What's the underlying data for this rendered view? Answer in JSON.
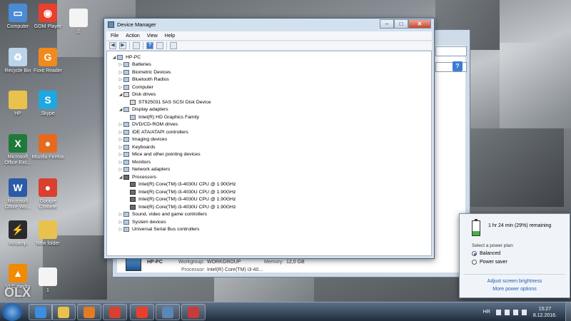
{
  "desktop": {
    "icons": [
      {
        "label": "Computer",
        "icon": "computer-icon",
        "color": "#4a8bd4"
      },
      {
        "label": "GOM Player",
        "icon": "gom-player-icon",
        "color": "#e8402c"
      },
      {
        "label": "2",
        "icon": "image-file-icon",
        "color": "#f4f4f4"
      },
      {
        "label": "Recycle Bin",
        "icon": "recycle-bin-icon",
        "color": "#bcd4ea"
      },
      {
        "label": "Foxit Reader",
        "icon": "foxit-reader-icon",
        "color": "#f08a1c"
      },
      {
        "label": "HP",
        "icon": "folder-icon",
        "color": "#e9c24d"
      },
      {
        "label": "Skype",
        "icon": "skype-icon",
        "color": "#1ea7e1"
      },
      {
        "label": "Microsoft Office Exc...",
        "icon": "excel-icon",
        "color": "#1f7a3a"
      },
      {
        "label": "Mozilla Firefox",
        "icon": "firefox-icon",
        "color": "#e66a1e"
      },
      {
        "label": "Microsoft Office Wo...",
        "icon": "word-icon",
        "color": "#2a5aa8"
      },
      {
        "label": "Google Chrome",
        "icon": "chrome-icon",
        "color": "#d9402f"
      },
      {
        "label": "Winamp",
        "icon": "winamp-icon",
        "color": "#2b2b2b"
      },
      {
        "label": "New folder",
        "icon": "folder-icon",
        "color": "#e9c24d"
      },
      {
        "label": "VLC media",
        "icon": "vlc-icon",
        "color": "#f08a00"
      },
      {
        "label": "1",
        "icon": "image-file-icon",
        "color": "#f4f4f4"
      }
    ],
    "watermark": "OLX"
  },
  "device_manager": {
    "title": "Device Manager",
    "menu": [
      "File",
      "Action",
      "View",
      "Help"
    ],
    "window_buttons": {
      "minimize": "–",
      "maximize": "□",
      "close": "✕"
    },
    "toolbar": {
      "help": "?"
    },
    "tree": [
      {
        "label": "HP-PC",
        "level": 0,
        "expanded": true,
        "icon": "computer-icon"
      },
      {
        "label": "Batteries",
        "level": 1,
        "expanded": false,
        "icon": "battery-icon"
      },
      {
        "label": "Biometric Devices",
        "level": 1,
        "expanded": false,
        "icon": "biometric-icon"
      },
      {
        "label": "Bluetooth Radios",
        "level": 1,
        "expanded": false,
        "icon": "bluetooth-icon"
      },
      {
        "label": "Computer",
        "level": 1,
        "expanded": false,
        "icon": "computer-icon"
      },
      {
        "label": "Disk drives",
        "level": 1,
        "expanded": true,
        "icon": "disk-icon"
      },
      {
        "label": "ST925031 5AS SCSI Disk Device",
        "level": 2,
        "expanded": null,
        "icon": "disk-icon"
      },
      {
        "label": "Display adapters",
        "level": 1,
        "expanded": true,
        "icon": "display-icon"
      },
      {
        "label": "Intel(R) HD Graphics Family",
        "level": 2,
        "expanded": null,
        "icon": "display-icon"
      },
      {
        "label": "DVD/CD-ROM drives",
        "level": 1,
        "expanded": false,
        "icon": "dvd-icon"
      },
      {
        "label": "IDE ATA/ATAPI controllers",
        "level": 1,
        "expanded": false,
        "icon": "ide-icon"
      },
      {
        "label": "Imaging devices",
        "level": 1,
        "expanded": false,
        "icon": "camera-icon"
      },
      {
        "label": "Keyboards",
        "level": 1,
        "expanded": false,
        "icon": "keyboard-icon"
      },
      {
        "label": "Mice and other pointing devices",
        "level": 1,
        "expanded": false,
        "icon": "mouse-icon"
      },
      {
        "label": "Monitors",
        "level": 1,
        "expanded": false,
        "icon": "monitor-icon"
      },
      {
        "label": "Network adapters",
        "level": 1,
        "expanded": false,
        "icon": "network-icon"
      },
      {
        "label": "Processors",
        "level": 1,
        "expanded": true,
        "icon": "chip-icon"
      },
      {
        "label": "Intel(R) Core(TM) i3-4030U CPU @ 1.90GHz",
        "level": 2,
        "expanded": null,
        "icon": "chip-icon"
      },
      {
        "label": "Intel(R) Core(TM) i3-4030U CPU @ 1.90GHz",
        "level": 2,
        "expanded": null,
        "icon": "chip-icon"
      },
      {
        "label": "Intel(R) Core(TM) i3-4030U CPU @ 1.90GHz",
        "level": 2,
        "expanded": null,
        "icon": "chip-icon"
      },
      {
        "label": "Intel(R) Core(TM) i3-4030U CPU @ 1.90GHz",
        "level": 2,
        "expanded": null,
        "icon": "chip-icon"
      },
      {
        "label": "Sound, video and game controllers",
        "level": 1,
        "expanded": false,
        "icon": "speaker-icon"
      },
      {
        "label": "System devices",
        "level": 1,
        "expanded": false,
        "icon": "system-icon"
      },
      {
        "label": "Universal Serial Bus controllers",
        "level": 1,
        "expanded": false,
        "icon": "usb-icon"
      }
    ]
  },
  "system_window": {
    "pc_name": "HP-PC",
    "workgroup_label": "Workgroup:",
    "workgroup_value": "WORKGROUP",
    "memory_label": "Memory:",
    "memory_value": "12,0 GB",
    "processor_label": "Processor:",
    "processor_value": "Intel(R) Core(TM) i3-40...",
    "help_label": "?"
  },
  "power": {
    "remaining": "1 hr 24 min (29%) remaining",
    "battery_level": 0.29,
    "plan_label": "Select a power plan:",
    "plans": [
      {
        "label": "Balanced",
        "selected": true
      },
      {
        "label": "Power saver",
        "selected": false
      }
    ],
    "link_brightness": "Adjust screen brightness",
    "link_options": "More power options"
  },
  "taskbar": {
    "pinned": [
      {
        "name": "ie-icon",
        "color": "#3b8ee0"
      },
      {
        "name": "explorer-icon",
        "color": "#e9c24d"
      },
      {
        "name": "media-player-icon",
        "color": "#e37b22"
      },
      {
        "name": "chrome-icon",
        "color": "#d9402f"
      },
      {
        "name": "gom-player-icon",
        "color": "#e8402c"
      },
      {
        "name": "device-manager-icon",
        "color": "#5a87b8"
      },
      {
        "name": "snipping-tool-icon",
        "color": "#c63b3b"
      }
    ],
    "language": "HR",
    "time": "15:27",
    "date": "8.12.2016."
  }
}
